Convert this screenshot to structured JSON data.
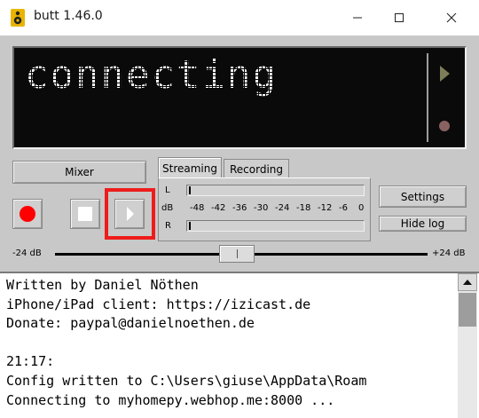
{
  "window": {
    "title": "butt 1.46.0"
  },
  "display": {
    "status_text": "connecting"
  },
  "mixer": {
    "label": "Mixer"
  },
  "tabs": [
    {
      "label": "Streaming"
    },
    {
      "label": "Recording"
    }
  ],
  "meter": {
    "left_label": "L",
    "db_label": "dB",
    "right_label": "R",
    "scale": [
      "-48",
      "-42",
      "-36",
      "-30",
      "-24",
      "-18",
      "-12",
      "-6",
      "0"
    ]
  },
  "buttons": {
    "settings": "Settings",
    "hide_log": "Hide log"
  },
  "gain": {
    "min_label": "-24 dB",
    "max_label": "+24 dB",
    "value_db": 0
  },
  "log": {
    "lines": [
      "Written by Daniel Nöthen",
      "iPhone/iPad client: https://izicast.de",
      "Donate: paypal@danielnoethen.de",
      "",
      "21:17:",
      "Config written to C:\\Users\\giuse\\AppData\\Roam",
      "Connecting to myhomepy.webhop.me:8000 ..."
    ]
  },
  "colors": {
    "record": "#ff0000",
    "highlight": "#ee1c1c",
    "display_bg": "#0a0a0a",
    "display_text": "#ffffff"
  },
  "icons": [
    "speaker-icon",
    "minimize-icon",
    "maximize-icon",
    "close-icon",
    "play-indicator-icon",
    "record-indicator-icon",
    "record-icon",
    "stop-icon",
    "play-icon",
    "scroll-up-icon"
  ]
}
